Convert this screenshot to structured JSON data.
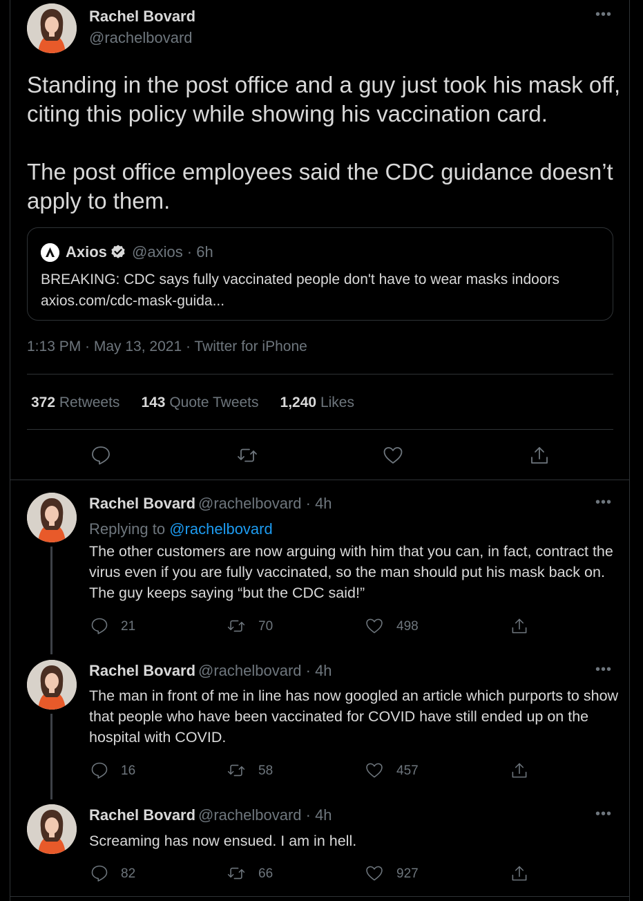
{
  "main_tweet": {
    "author_name": "Rachel Bovard",
    "author_handle": "@rachelbovard",
    "text": "Standing in the post office and a guy just took his mask off, citing this policy while showing his vaccination card.\n\nThe post office employees said the CDC guidance doesn’t apply to them.",
    "quote": {
      "name": "Axios",
      "handle_time": "@axios · 6h",
      "text": "BREAKING: CDC says fully vaccinated people don't have to wear masks indoors axios.com/cdc-mask-guida..."
    },
    "meta": "1:13 PM · May 13, 2021 · Twitter for iPhone",
    "stats": {
      "retweets_count": "372",
      "retweets_label": "Retweets",
      "quotes_count": "143",
      "quotes_label": "Quote Tweets",
      "likes_count": "1,240",
      "likes_label": "Likes"
    },
    "more_label": "•••"
  },
  "replies": [
    {
      "name": "Rachel Bovard",
      "handle_time": "@rachelbovard · 4h",
      "replying_prefix": "Replying to",
      "replying_to": "@rachelbovard",
      "text": "The other customers are now arguing with him that you can, in fact, contract the virus even if you are fully vaccinated, so the man should put his mask back on. The guy keeps saying “but the CDC said!”",
      "replies": "21",
      "retweets": "70",
      "likes": "498"
    },
    {
      "name": "Rachel Bovard",
      "handle_time": "@rachelbovard · 4h",
      "text": "The man in front of me in line has now googled an article which purports to show that people who have been vaccinated for COVID have still ended up on the hospital with COVID.",
      "replies": "16",
      "retweets": "58",
      "likes": "457"
    },
    {
      "name": "Rachel Bovard",
      "handle_time": "@rachelbovard · 4h",
      "text": "Screaming has now ensued. I am in hell.",
      "replies": "82",
      "retweets": "66",
      "likes": "927"
    }
  ],
  "colors": {
    "background": "#000000",
    "text": "#d9d9d9",
    "muted": "#6e767d",
    "link": "#1d9bf0",
    "border": "#2f3336"
  },
  "icons": [
    "reply-icon",
    "retweet-icon",
    "like-icon",
    "share-icon",
    "more-icon",
    "verified-icon",
    "axios-logo"
  ]
}
